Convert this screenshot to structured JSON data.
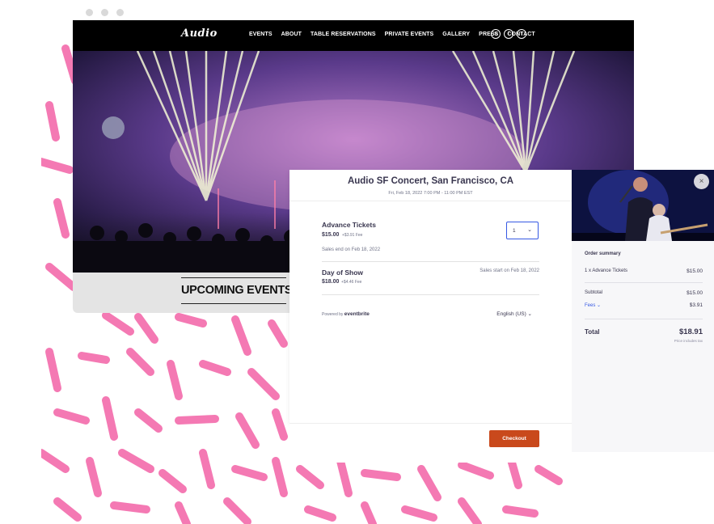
{
  "site": {
    "logo": "Audio",
    "nav": [
      "EVENTS",
      "ABOUT",
      "TABLE RESERVATIONS",
      "PRIVATE EVENTS",
      "GALLERY",
      "PRESS",
      "CONTACT"
    ],
    "social_icons": [
      "instagram-icon",
      "facebook-icon",
      "twitter-icon"
    ],
    "upcoming_heading": "UPCOMING EVENTS"
  },
  "checkout": {
    "event_title": "Audio SF Concert, San Francisco, CA",
    "event_date": "Fri, Feb 18, 2022 7:00 PM - 11:00 PM EST",
    "tickets": [
      {
        "name": "Advance Tickets",
        "price": "$15.00",
        "fee": "+$3.91 Fee",
        "sales_note": "Sales end on Feb 18, 2022",
        "quantity": "1"
      },
      {
        "name": "Day of Show",
        "price": "$18.00",
        "fee": "+$4.46 Fee",
        "sales_note": "Sales start on Feb 18, 2022"
      }
    ],
    "powered_by": "Powered by",
    "brand": "eventbrite",
    "language": "English (US)",
    "checkout_label": "Checkout"
  },
  "summary": {
    "title": "Order summary",
    "item": "1 x Advance Tickets",
    "item_price": "$15.00",
    "subtotal_label": "Subtotal",
    "subtotal": "$15.00",
    "fees_label": "Fees",
    "fees": "$3.91",
    "total_label": "Total",
    "total": "$18.91",
    "tax_note": "Price includes tax",
    "close_symbol": "×"
  },
  "colors": {
    "accent": "#c9491c",
    "link": "#3659e3",
    "pattern": "#f479b3"
  }
}
